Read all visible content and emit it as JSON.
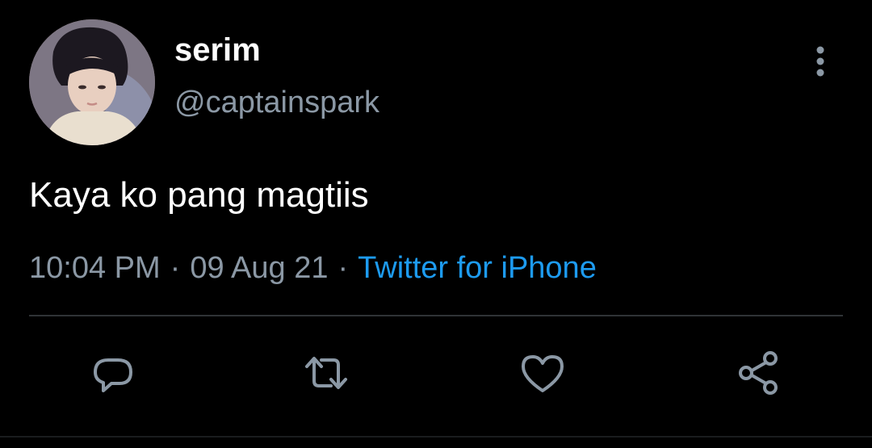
{
  "tweet": {
    "display_name": "serim",
    "handle": "@captainspark",
    "text": "Kaya ko pang magtiis",
    "time": "10:04 PM",
    "separator": "·",
    "date": "09 Aug 21",
    "source": "Twitter for iPhone"
  },
  "colors": {
    "background": "#000000",
    "primary_text": "#ffffff",
    "secondary_text": "#8b98a5",
    "link": "#1d9bf0",
    "divider": "#2f3336"
  },
  "icons": {
    "more": "more-vertical-icon",
    "reply": "reply-icon",
    "retweet": "retweet-icon",
    "like": "heart-icon",
    "share": "share-icon"
  }
}
